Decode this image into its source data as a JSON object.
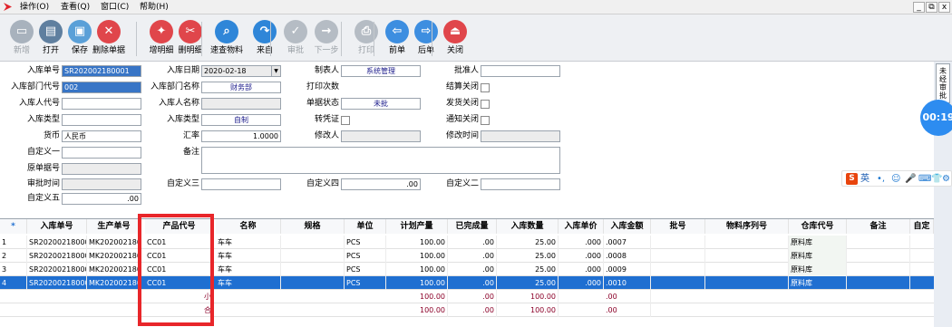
{
  "menu": {
    "items": [
      "操作(O)",
      "查看(Q)",
      "窗口(C)",
      "帮助(H)"
    ],
    "window_controls": [
      "_",
      "⧉",
      "x"
    ]
  },
  "toolbar": {
    "buttons": [
      {
        "label": "新增",
        "icon": "new-doc-icon",
        "color": "#a8b2bd",
        "disabled": true
      },
      {
        "label": "打开",
        "icon": "open-icon",
        "color": "#5f7f9f",
        "disabled": false
      },
      {
        "label": "保存",
        "icon": "save-icon",
        "color": "#5aa0d8",
        "disabled": false
      },
      {
        "label": "删除单据",
        "icon": "delete-icon",
        "color": "#e0464b",
        "disabled": false
      },
      {
        "label": "增明细",
        "icon": "add-detail-icon",
        "color": "#e0464b",
        "disabled": false
      },
      {
        "label": "删明细",
        "icon": "remove-detail-icon",
        "color": "#e0464b",
        "disabled": false
      },
      {
        "label": "速查物料",
        "icon": "search-icon",
        "color": "#2f86d8",
        "disabled": false
      },
      {
        "label": "来自",
        "icon": "share-icon",
        "color": "#2f86d8",
        "disabled": false
      },
      {
        "label": "审批",
        "icon": "approve-icon",
        "color": "#b5bcc4",
        "disabled": true
      },
      {
        "label": "下一步",
        "icon": "next-step-icon",
        "color": "#b5bcc4",
        "disabled": true
      },
      {
        "label": "打印",
        "icon": "print-icon",
        "color": "#b5bcc4",
        "disabled": true
      },
      {
        "label": "前单",
        "icon": "prev-icon",
        "color": "#3d8ee0",
        "disabled": false
      },
      {
        "label": "后单",
        "icon": "next-icon",
        "color": "#3d8ee0",
        "disabled": false
      },
      {
        "label": "关闭",
        "icon": "close-icon",
        "color": "#e0464b",
        "disabled": false
      }
    ]
  },
  "form": {
    "receipt_no": {
      "label": "入库单号",
      "value": "SR202002180001"
    },
    "receipt_date": {
      "label": "入库日期",
      "value": "2020-02-18"
    },
    "creator": {
      "label": "制表人",
      "value": "系统管理"
    },
    "approver": {
      "label": "批准人",
      "value": ""
    },
    "dept_code": {
      "label": "入库部门代号",
      "value": "002"
    },
    "dept_name": {
      "label": "入库部门名称",
      "value": "财务部"
    },
    "print_count": {
      "label": "打印次数",
      "value": ""
    },
    "settle_closed": {
      "label": "结算关闭"
    },
    "person_code": {
      "label": "入库人代号",
      "value": ""
    },
    "person_name": {
      "label": "入库人名称",
      "value": ""
    },
    "doc_status": {
      "label": "单据状态",
      "value": "未批"
    },
    "invoice_closed": {
      "label": "发货关闭"
    },
    "in_type": {
      "label": "入库类型",
      "value": ""
    },
    "in_type2": {
      "label": "入库类型",
      "value": "自制"
    },
    "to_voucher": {
      "label": "转凭证"
    },
    "notice_closed": {
      "label": "通知关闭"
    },
    "currency": {
      "label": "货币",
      "value": "人民币"
    },
    "exchange_rate": {
      "label": "汇率",
      "value": "1.0000"
    },
    "modifier": {
      "label": "修改人",
      "value": ""
    },
    "modify_time": {
      "label": "修改时间",
      "value": ""
    },
    "custom1": {
      "label": "自定义一",
      "value": ""
    },
    "remark": {
      "label": "备注",
      "value": ""
    },
    "orig_no": {
      "label": "原单据号",
      "value": ""
    },
    "approve_time": {
      "label": "审批时间",
      "value": ""
    },
    "custom3": {
      "label": "自定义三",
      "value": ""
    },
    "custom4": {
      "label": "自定义四",
      "value": ".00"
    },
    "custom2": {
      "label": "自定义二",
      "value": ""
    },
    "custom5": {
      "label": "自定义五",
      "value": ".00"
    }
  },
  "grid": {
    "corner": "*",
    "columns": [
      "入库单号",
      "生产单号",
      "产品代号",
      "名称",
      "规格",
      "单位",
      "计划产量",
      "已完成量",
      "入库数量",
      "入库单价",
      "入库金额",
      "批号",
      "物料序列号",
      "仓库代号",
      "备注",
      "自定"
    ],
    "rows": [
      {
        "idx": "1",
        "receipt": "SR202002180001",
        "prod": "MK2020021800",
        "code": "CC01",
        "name": "车车",
        "spec": "",
        "unit": "PCS",
        "plan": "100.00",
        "done": ".00",
        "qty": "25.00",
        "price": ".000",
        "amount": ".0007",
        "batch": "",
        "serial": "",
        "wh": "原料库",
        "note": ""
      },
      {
        "idx": "2",
        "receipt": "SR202002180001",
        "prod": "MK2020021800",
        "code": "CC01",
        "name": "车车",
        "spec": "",
        "unit": "PCS",
        "plan": "100.00",
        "done": ".00",
        "qty": "25.00",
        "price": ".000",
        "amount": ".0008",
        "batch": "",
        "serial": "",
        "wh": "原料库",
        "note": ""
      },
      {
        "idx": "3",
        "receipt": "SR202002180001",
        "prod": "MK2020021800",
        "code": "CC01",
        "name": "车车",
        "spec": "",
        "unit": "PCS",
        "plan": "100.00",
        "done": ".00",
        "qty": "25.00",
        "price": ".000",
        "amount": ".0009",
        "batch": "",
        "serial": "",
        "wh": "原料库",
        "note": ""
      },
      {
        "idx": "4",
        "receipt": "SR202002180001",
        "prod": "MK2020021800",
        "code": "CC01",
        "name": "车车",
        "spec": "",
        "unit": "PCS",
        "plan": "100.00",
        "done": ".00",
        "qty": "25.00",
        "price": ".000",
        "amount": ".0010",
        "batch": "",
        "serial": "",
        "wh": "原料库",
        "note": ""
      }
    ],
    "subtotal": {
      "label": "小",
      "plan": "100.00",
      "done": ".00",
      "qty": "100.00",
      "amount": ".00"
    },
    "total": {
      "label": "合",
      "plan": "100.00",
      "done": ".00",
      "qty": "100.00",
      "amount": ".00"
    }
  },
  "side": {
    "tab_label": "未经审批",
    "timer": "00:19"
  },
  "ime": {
    "logo": "S",
    "lang": "英",
    "glyphs": [
      "•,",
      "☺",
      "🎤",
      "⌨",
      "👕",
      "⚙"
    ]
  },
  "colors": {
    "accent": "#1f6fd1",
    "highlight": "#e8262a",
    "total_text": "#8b0028"
  }
}
